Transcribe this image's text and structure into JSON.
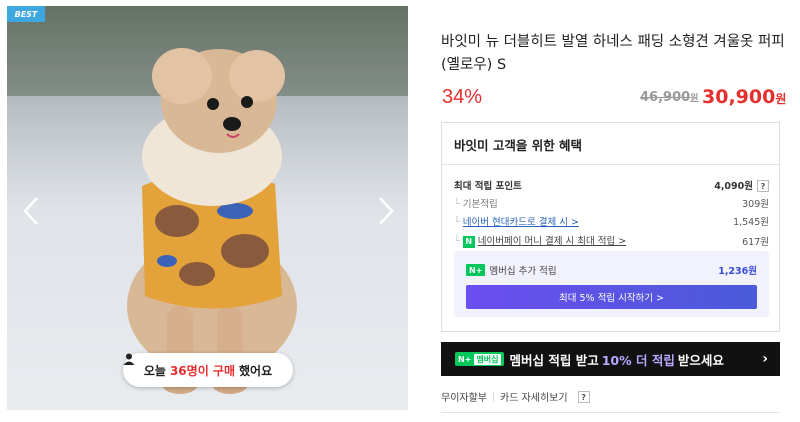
{
  "gallery": {
    "badge": "BEST",
    "purchase_prefix": "오늘",
    "purchase_count": "36명이 구매",
    "purchase_suffix": "했어요"
  },
  "product": {
    "title": "바잇미 뉴 더블히트 발열 하네스 패딩 소형견 겨울옷 퍼피 (옐로우) S",
    "discount": "34%",
    "original_price": "46,900",
    "original_unit": "원",
    "sale_price": "30,900",
    "sale_unit": "원"
  },
  "benefits": {
    "title": "바잇미 고객을 위한 혜택",
    "max_points_label": "최대 적립 포인트",
    "max_points_value": "4,090원",
    "rows": [
      {
        "label": "기본적립",
        "value": "309원"
      },
      {
        "label": "네이버 현대카드로 결제 시 >",
        "value": "1,545원"
      },
      {
        "label": "네이버페이 머니 결제 시 최대 적립 >",
        "value": "617원"
      }
    ],
    "membership_label": "멤버십 추가 적립",
    "membership_value": "1,236원",
    "membership_button": "최대 5% 적립 시작하기 >"
  },
  "banner": {
    "tag": "N+",
    "tag_text": "멤버십",
    "text_a": "멤버십 적립 받고",
    "highlight": "10% 더 적립",
    "text_b": "받으세요",
    "chevron": "›"
  },
  "card_info": {
    "installment": "무이자할부",
    "details": "카드 자세히보기",
    "help": "?"
  },
  "colors": {
    "accent_red": "#e52e2e",
    "naver_green": "#03c75a",
    "membership_purple": "#5b52e6"
  }
}
